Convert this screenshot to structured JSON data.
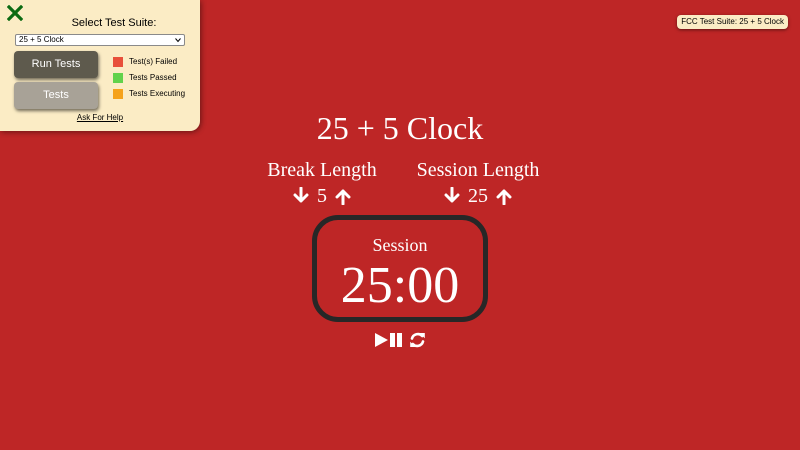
{
  "test_panel": {
    "title": "Select Test Suite:",
    "selected_suite": "25 + 5 Clock",
    "run_tests_label": "Run Tests",
    "tests_label": "Tests",
    "legend": [
      {
        "label": "Test(s) Failed",
        "color": "#e8503a"
      },
      {
        "label": "Tests Passed",
        "color": "#62d24b"
      },
      {
        "label": "Tests Executing",
        "color": "#f5a21b"
      }
    ],
    "help_link": "Ask For Help",
    "close_icon_color": "#0c6b12"
  },
  "badge": {
    "text": "FCC Test Suite: 25 + 5 Clock"
  },
  "clock": {
    "title": "25 + 5 Clock",
    "break": {
      "label": "Break Length",
      "value": "5"
    },
    "session": {
      "label": "Session Length",
      "value": "25"
    },
    "timer": {
      "label": "Session",
      "time_left": "25:00"
    },
    "icons": {
      "decrement": "arrow-down-icon",
      "increment": "arrow-up-icon",
      "start_stop": "play-pause-icon",
      "reset": "refresh-icon"
    }
  },
  "colors": {
    "background": "#be2626",
    "panel_bg": "#fbecc5",
    "run_button": "#5e5a4d",
    "tests_button": "#a8a297",
    "timer_border": "#272727"
  }
}
